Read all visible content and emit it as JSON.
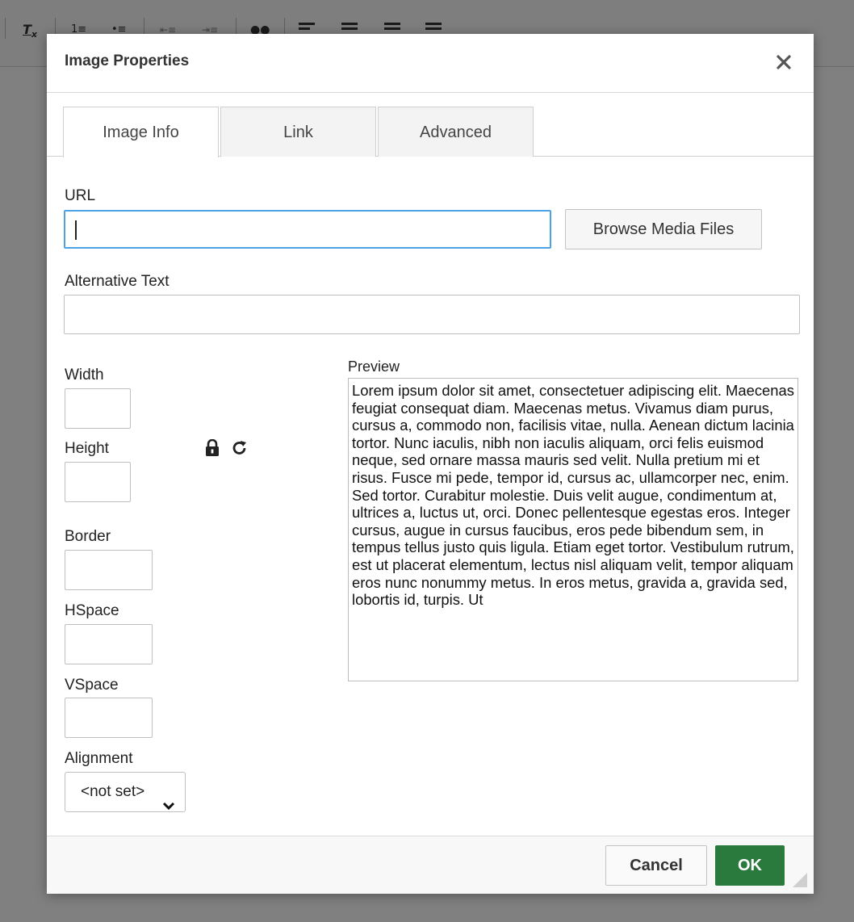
{
  "toolbar": {
    "remove_format_icon": "remove-format-icon",
    "icons": [
      "numbered-list-icon",
      "bulleted-list-icon",
      "decrease-indent-icon",
      "increase-indent-icon",
      "block-icon",
      "align-left-icon",
      "align-center-icon",
      "align-right-icon",
      "justify-icon"
    ]
  },
  "dialog": {
    "title": "Image Properties",
    "close_icon": "close-icon",
    "tabs": [
      {
        "label": "Image Info",
        "active": true
      },
      {
        "label": "Link",
        "active": false
      },
      {
        "label": "Advanced",
        "active": false
      }
    ]
  },
  "form": {
    "url_label": "URL",
    "url_value": "",
    "browse_label": "Browse Media Files",
    "alt_label": "Alternative Text",
    "alt_value": "",
    "width_label": "Width",
    "height_label": "Height",
    "border_label": "Border",
    "hspace_label": "HSpace",
    "vspace_label": "VSpace",
    "alignment_label": "Alignment",
    "alignment_value": "<not set>",
    "lock_icon": "lock-icon",
    "reset_icon": "reset-size-icon"
  },
  "preview": {
    "label": "Preview",
    "text": "Lorem ipsum dolor sit amet, consectetuer adipiscing elit. Maecenas feugiat consequat diam. Maecenas metus. Vivamus diam purus, cursus a, commodo non, facilisis vitae, nulla. Aenean dictum lacinia tortor. Nunc iaculis, nibh non iaculis aliquam, orci felis euismod neque, sed ornare massa mauris sed velit. Nulla pretium mi et risus. Fusce mi pede, tempor id, cursus ac, ullamcorper nec, enim. Sed tortor. Curabitur molestie. Duis velit augue, condimentum at, ultrices a, luctus ut, orci. Donec pellentesque egestas eros. Integer cursus, augue in cursus faucibus, eros pede bibendum sem, in tempus tellus justo quis ligula. Etiam eget tortor. Vestibulum rutrum, est ut placerat elementum, lectus nisl aliquam velit, tempor aliquam eros nunc nonummy metus. In eros metus, gravida a, gravida sed, lobortis id, turpis. Ut"
  },
  "footer": {
    "cancel_label": "Cancel",
    "ok_label": "OK"
  },
  "colors": {
    "ok_green": "#2b7a3d",
    "focus_blue": "#4aa3e4",
    "overlay_gray": "#808080"
  }
}
